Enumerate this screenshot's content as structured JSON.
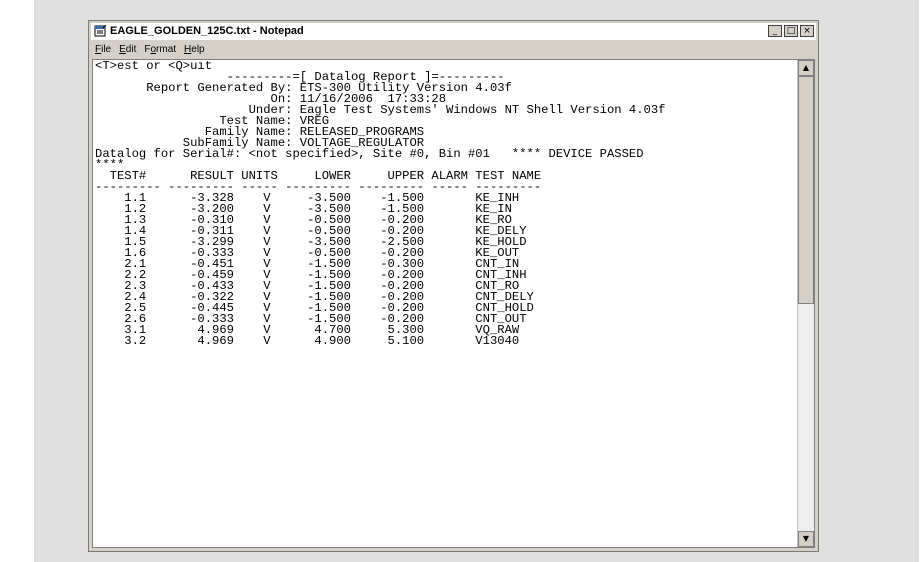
{
  "window": {
    "title": "EAGLE_GOLDEN_125C.txt - Notepad",
    "controls": {
      "minimize": "_",
      "maximize": "□",
      "close": "×"
    }
  },
  "menu": [
    "File",
    "Edit",
    "Format",
    "Help"
  ],
  "content": {
    "lines": [
      "<T>est or <Q>uit",
      "                  ---------=[ Datalog Report ]=---------",
      "",
      "       Report Generated By: ETS-300 Utility Version 4.03f",
      "                        On: 11/16/2006  17:33:28",
      "                     Under: Eagle Test Systems' Windows NT Shell Version 4.03f",
      "",
      "                 Test Name: VREG",
      "               Family Name: RELEASED_PROGRAMS",
      "            SubFamily Name: VOLTAGE_REGULATOR",
      "",
      "",
      "Datalog for Serial#: <not specified>, Site #0, Bin #01   **** DEVICE PASSED",
      "****",
      "  TEST#      RESULT UNITS     LOWER     UPPER ALARM TEST NAME",
      "--------- --------- ----- --------- --------- ----- ---------",
      "    1.1      -3.328    V     -3.500    -1.500       KE_INH",
      "    1.2      -3.200    V     -3.500    -1.500       KE_IN",
      "    1.3      -0.310    V     -0.500    -0.200       KE_RO",
      "    1.4      -0.311    V     -0.500    -0.200       KE_DELY",
      "    1.5      -3.299    V     -3.500    -2.500       KE_HOLD",
      "    1.6      -0.333    V     -0.500    -0.200       KE_OUT",
      "    2.1      -0.451    V     -1.500    -0.300       CNT_IN",
      "    2.2      -0.459    V     -1.500    -0.200       CNT_INH",
      "    2.3      -0.433    V     -1.500    -0.200       CNT_RO",
      "    2.4      -0.322    V     -1.500    -0.200       CNT_DELY",
      "    2.5      -0.445    V     -1.500    -0.200       CNT_HOLD",
      "    2.6      -0.333    V     -1.500    -0.200       CNT_OUT",
      "    3.1       4.969    V      4.700     5.300       VQ_RAW",
      "    3.2       4.969    V      4.900     5.100       V13040"
    ]
  },
  "scrollbar": {
    "up_glyph": "▲",
    "down_glyph": "▼"
  }
}
